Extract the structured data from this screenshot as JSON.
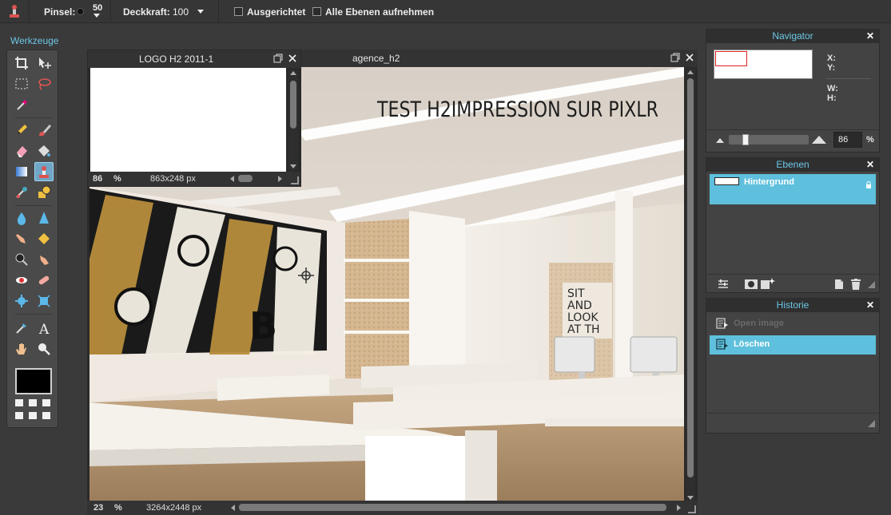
{
  "topbar": {
    "brush_label": "Pinsel:",
    "brush_size": "50",
    "opacity_label": "Deckkraft:",
    "opacity_value": "100",
    "aligned_label": "Ausgerichtet",
    "all_layers_label": "Alle Ebenen aufnehmen"
  },
  "toolbox": {
    "title": "Werkzeuge",
    "foreground_color": "#000000"
  },
  "doc_logo": {
    "title": "LOGO H2 2011-1",
    "zoom": "86",
    "percent": "%",
    "size": "863x248 px"
  },
  "doc_main": {
    "title": "agence_h2",
    "zoom": "23",
    "percent": "%",
    "size": "3264x2448 px",
    "overlay_text": "TEST H2IMPRESSION SUR PIXLR",
    "poster_text": [
      "SIT",
      "AND",
      "LOOK",
      "AT TH"
    ]
  },
  "navigator": {
    "title": "Navigator",
    "x_label": "X:",
    "y_label": "Y:",
    "w_label": "W:",
    "h_label": "H:",
    "zoom_value": "86",
    "percent": "%",
    "zoom_fraction": 0.19
  },
  "layers": {
    "title": "Ebenen",
    "items": [
      {
        "name": "Hintergrund",
        "locked": true
      }
    ]
  },
  "history": {
    "title": "Historie",
    "items": [
      {
        "label": "Open image",
        "active": false
      },
      {
        "label": "Löschen",
        "active": true
      }
    ]
  },
  "colors": {
    "accent": "#5ec0dc",
    "panel_head_text": "#6cc7e6"
  },
  "close_glyph": "✕"
}
